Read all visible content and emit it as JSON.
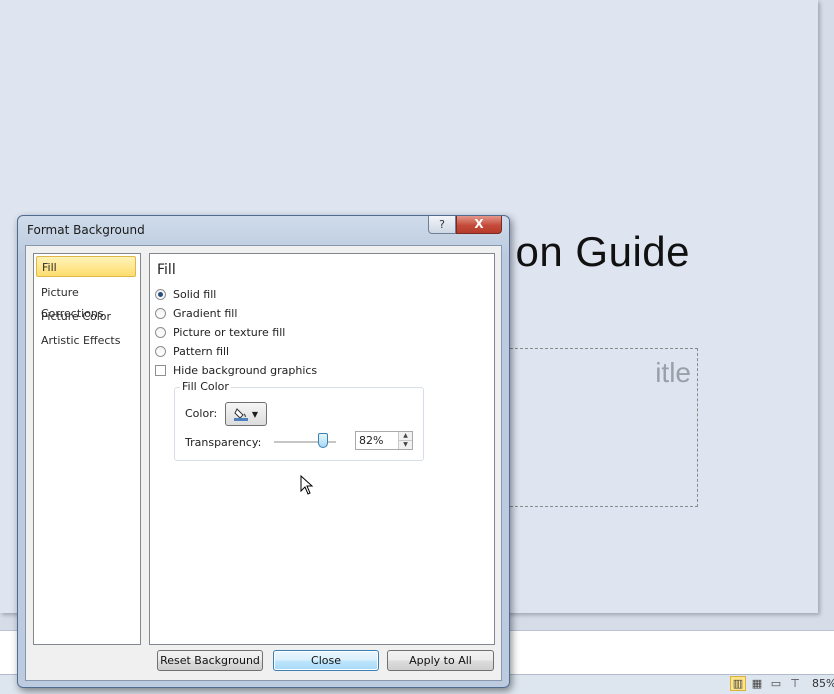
{
  "background": {
    "slide_title": "on Guide",
    "subtitle_placeholder": "itle",
    "status_bar": {
      "zoom": "85%"
    }
  },
  "dialog": {
    "title": "Format Background",
    "help_label": "?",
    "close_label": "X",
    "nav_items": [
      {
        "label": "Fill",
        "selected": true
      },
      {
        "label": "Picture Corrections",
        "selected": false
      },
      {
        "label": "Picture Color",
        "selected": false
      },
      {
        "label": "Artistic Effects",
        "selected": false
      }
    ],
    "pane_title": "Fill",
    "fill_options": [
      {
        "label": "Solid fill",
        "checked": true
      },
      {
        "label": "Gradient fill",
        "checked": false
      },
      {
        "label": "Picture or texture fill",
        "checked": false
      },
      {
        "label": "Pattern fill",
        "checked": false
      }
    ],
    "hide_background_graphics": {
      "label": "Hide background graphics",
      "checked": false
    },
    "fill_color": {
      "legend": "Fill Color",
      "color_label": "Color:",
      "color_swatch": "#4f81bd",
      "transparency_label": "Transparency:",
      "transparency_value": "82%",
      "transparency_percent": 82
    },
    "buttons": {
      "reset": "Reset Background",
      "close": "Close",
      "apply_all": "Apply to All"
    }
  }
}
